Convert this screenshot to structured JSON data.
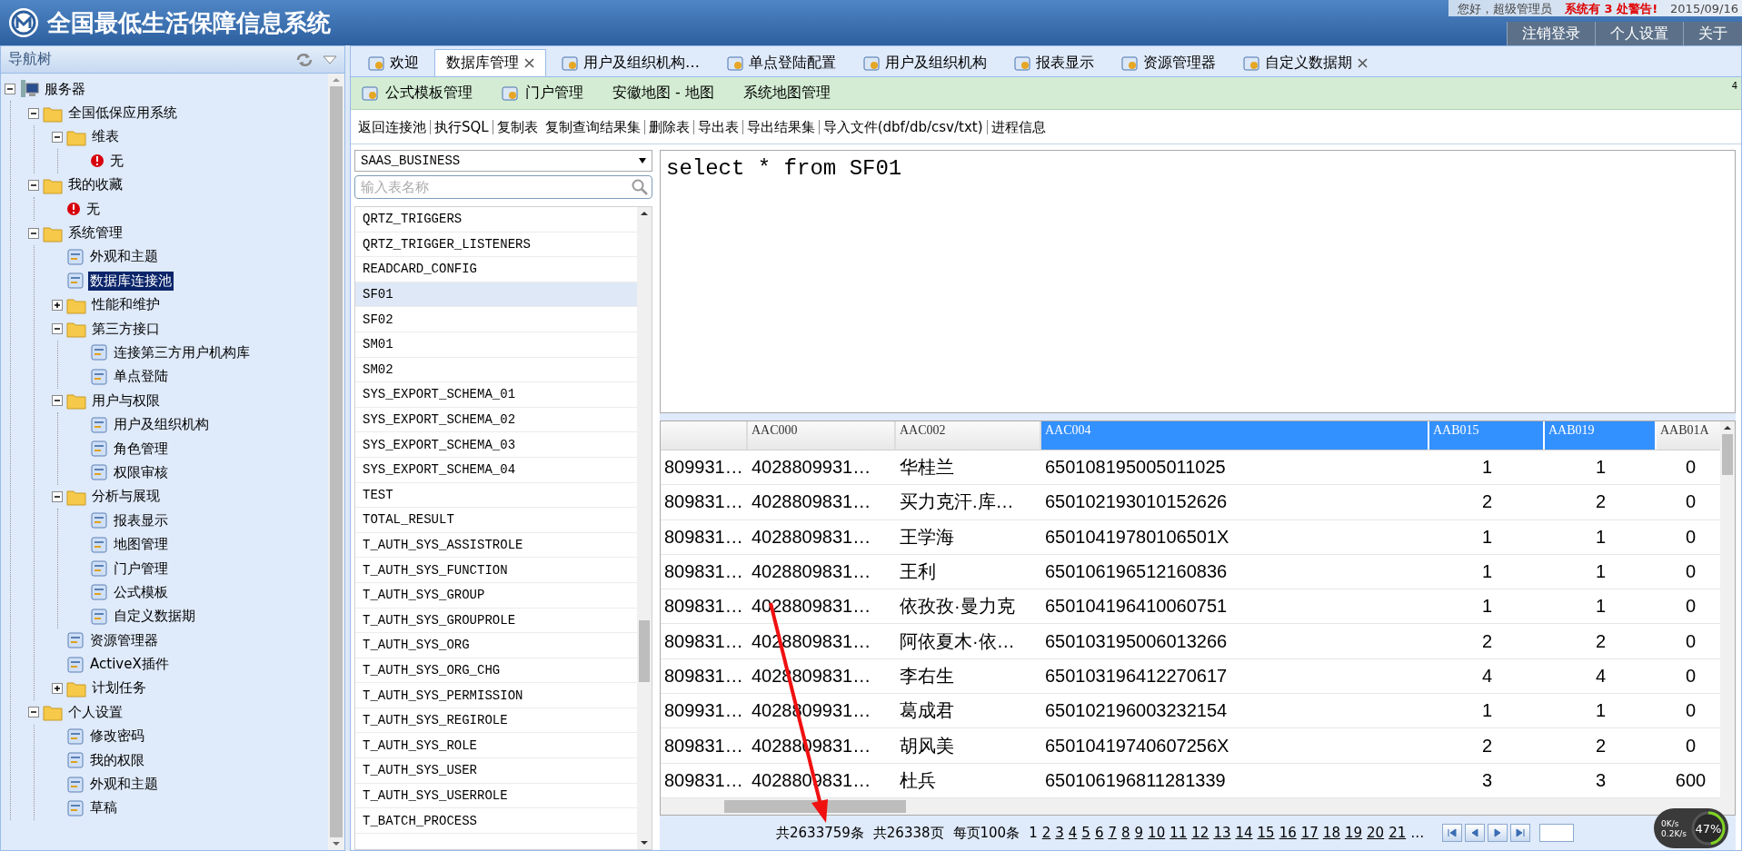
{
  "header": {
    "title": "全国最低生活保障信息系统",
    "greeting": "您好，超级管理员",
    "warning": "系统有 3 处警告!",
    "date": "2015/09/16",
    "buttons": [
      "注销登录",
      "个人设置",
      "关于"
    ]
  },
  "nav": {
    "title": "导航树",
    "tree": [
      {
        "label": "服务器",
        "kind": "server",
        "expanded": true,
        "selected": false,
        "children": [
          {
            "label": "全国低保应用系统",
            "kind": "folder",
            "expanded": true,
            "selected": false,
            "children": [
              {
                "label": "维表",
                "kind": "folder",
                "expanded": true,
                "selected": false,
                "children": [
                  {
                    "label": "无",
                    "kind": "warning",
                    "selected": false
                  }
                ]
              }
            ]
          },
          {
            "label": "我的收藏",
            "kind": "folder",
            "expanded": true,
            "selected": false,
            "children": [
              {
                "label": "无",
                "kind": "warning",
                "selected": false
              }
            ]
          },
          {
            "label": "系统管理",
            "kind": "folder",
            "expanded": true,
            "selected": false,
            "children": [
              {
                "label": "外观和主题",
                "kind": "item",
                "selected": false
              },
              {
                "label": "数据库连接池",
                "kind": "item",
                "selected": true
              },
              {
                "label": "性能和维护",
                "kind": "folder",
                "expanded": false,
                "selected": false
              },
              {
                "label": "第三方接口",
                "kind": "folder",
                "expanded": true,
                "selected": false,
                "children": [
                  {
                    "label": "连接第三方用户机构库",
                    "kind": "item",
                    "selected": false
                  },
                  {
                    "label": "单点登陆",
                    "kind": "item",
                    "selected": false
                  }
                ]
              },
              {
                "label": "用户与权限",
                "kind": "folder",
                "expanded": true,
                "selected": false,
                "children": [
                  {
                    "label": "用户及组织机构",
                    "kind": "item",
                    "selected": false
                  },
                  {
                    "label": "角色管理",
                    "kind": "item",
                    "selected": false
                  },
                  {
                    "label": "权限审核",
                    "kind": "item",
                    "selected": false
                  }
                ]
              },
              {
                "label": "分析与展现",
                "kind": "folder",
                "expanded": true,
                "selected": false,
                "children": [
                  {
                    "label": "报表显示",
                    "kind": "item",
                    "selected": false
                  },
                  {
                    "label": "地图管理",
                    "kind": "item",
                    "selected": false
                  },
                  {
                    "label": "门户管理",
                    "kind": "item",
                    "selected": false
                  },
                  {
                    "label": "公式模板",
                    "kind": "item",
                    "selected": false
                  },
                  {
                    "label": "自定义数据期",
                    "kind": "item",
                    "selected": false
                  }
                ]
              },
              {
                "label": "资源管理器",
                "kind": "item",
                "selected": false
              },
              {
                "label": "ActiveX插件",
                "kind": "item",
                "selected": false
              },
              {
                "label": "计划任务",
                "kind": "folder",
                "expanded": false,
                "selected": false
              }
            ]
          },
          {
            "label": "个人设置",
            "kind": "folder",
            "expanded": true,
            "selected": false,
            "children": [
              {
                "label": "修改密码",
                "kind": "item",
                "selected": false
              },
              {
                "label": "我的权限",
                "kind": "item",
                "selected": false
              },
              {
                "label": "外观和主题",
                "kind": "item",
                "selected": false
              },
              {
                "label": "草稿",
                "kind": "item",
                "selected": false
              }
            ]
          }
        ]
      }
    ]
  },
  "tabs": [
    {
      "label": "欢迎",
      "icon": true,
      "closable": false,
      "selected": false
    },
    {
      "label": "数据库管理",
      "icon": false,
      "closable": true,
      "selected": true
    },
    {
      "label": "用户及组织机构…",
      "icon": true,
      "closable": false,
      "selected": false
    },
    {
      "label": "单点登陆配置",
      "icon": true,
      "closable": false,
      "selected": false
    },
    {
      "label": "用户及组织机构",
      "icon": true,
      "closable": false,
      "selected": false
    },
    {
      "label": "报表显示",
      "icon": true,
      "closable": false,
      "selected": false
    },
    {
      "label": "资源管理器",
      "icon": true,
      "closable": false,
      "selected": false
    },
    {
      "label": "自定义数据期",
      "icon": true,
      "closable": true,
      "selected": false
    }
  ],
  "tab_count": "4",
  "subtabs": [
    {
      "label": "公式模板管理",
      "icon": true
    },
    {
      "label": "门户管理",
      "icon": true
    },
    {
      "label": "安徽地图 - 地图",
      "icon": false
    },
    {
      "label": "系统地图管理",
      "icon": false
    }
  ],
  "toolbar": [
    {
      "label": "返回连接池",
      "divider_after": true
    },
    {
      "label": "执行SQL",
      "divider_after": true
    },
    {
      "label": "复制表",
      "divider_after": false
    },
    {
      "label": "复制查询结果集",
      "divider_after": true
    },
    {
      "label": "删除表",
      "divider_after": true
    },
    {
      "label": "导出表",
      "divider_after": true
    },
    {
      "label": "导出结果集",
      "divider_after": true
    },
    {
      "label": "导入文件(dbf/db/csv/txt)",
      "divider_after": true
    },
    {
      "label": "进程信息",
      "divider_after": false
    }
  ],
  "db_select": "SAAS_BUSINESS",
  "table_search": {
    "placeholder": "输入表名称"
  },
  "tables": [
    {
      "name": "QRTZ_TRIGGERS",
      "selected": false
    },
    {
      "name": "QRTZ_TRIGGER_LISTENERS",
      "selected": false
    },
    {
      "name": "READCARD_CONFIG",
      "selected": false
    },
    {
      "name": "SF01",
      "selected": true
    },
    {
      "name": "SF02",
      "selected": false
    },
    {
      "name": "SM01",
      "selected": false
    },
    {
      "name": "SM02",
      "selected": false
    },
    {
      "name": "SYS_EXPORT_SCHEMA_01",
      "selected": false
    },
    {
      "name": "SYS_EXPORT_SCHEMA_02",
      "selected": false
    },
    {
      "name": "SYS_EXPORT_SCHEMA_03",
      "selected": false
    },
    {
      "name": "SYS_EXPORT_SCHEMA_04",
      "selected": false
    },
    {
      "name": "TEST",
      "selected": false
    },
    {
      "name": "TOTAL_RESULT",
      "selected": false
    },
    {
      "name": "T_AUTH_SYS_ASSISTROLE",
      "selected": false
    },
    {
      "name": "T_AUTH_SYS_FUNCTION",
      "selected": false
    },
    {
      "name": "T_AUTH_SYS_GROUP",
      "selected": false
    },
    {
      "name": "T_AUTH_SYS_GROUPROLE",
      "selected": false
    },
    {
      "name": "T_AUTH_SYS_ORG",
      "selected": false
    },
    {
      "name": "T_AUTH_SYS_ORG_CHG",
      "selected": false
    },
    {
      "name": "T_AUTH_SYS_PERMISSION",
      "selected": false
    },
    {
      "name": "T_AUTH_SYS_REGIROLE",
      "selected": false
    },
    {
      "name": "T_AUTH_SYS_ROLE",
      "selected": false
    },
    {
      "name": "T_AUTH_SYS_USER",
      "selected": false
    },
    {
      "name": "T_AUTH_SYS_USERROLE",
      "selected": false
    },
    {
      "name": "T_BATCH_PROCESS",
      "selected": false
    }
  ],
  "editor": {
    "sql": "select * from SF01"
  },
  "grid": {
    "columns": [
      {
        "selected": false
      },
      {
        "label": "AAC000",
        "selected": false
      },
      {
        "label": "AAC002",
        "selected": false
      },
      {
        "label": "AAC004",
        "selected": true
      },
      {
        "label": "AAB015",
        "selected": true
      },
      {
        "label": "AAB019",
        "selected": true
      },
      {
        "label": "AAB01A",
        "selected": false
      }
    ],
    "rows": [
      [
        "809931…",
        "4028809931…",
        "华桂兰",
        "650108195005011025",
        "1",
        "1",
        "0"
      ],
      [
        "809831…",
        "4028809831…",
        "买力克汗.库…",
        "650102193010152626",
        "2",
        "2",
        "0"
      ],
      [
        "809831…",
        "4028809831…",
        "王学海",
        "65010419780106501X",
        "1",
        "1",
        "0"
      ],
      [
        "809831…",
        "4028809831…",
        "王利",
        "650106196512160836",
        "1",
        "1",
        "0"
      ],
      [
        "809831…",
        "4028809831…",
        "依孜孜·曼力克",
        "650104196410060751",
        "1",
        "1",
        "0"
      ],
      [
        "809831…",
        "4028809831…",
        "阿依夏木·依…",
        "650103195006013266",
        "2",
        "2",
        "0"
      ],
      [
        "809831…",
        "4028809831…",
        "李右生",
        "650103196412270617",
        "4",
        "4",
        "0"
      ],
      [
        "809931…",
        "4028809931…",
        "葛成君",
        "650102196003232154",
        "1",
        "1",
        "0"
      ],
      [
        "809831…",
        "4028809831…",
        "胡风美",
        "65010419740607256X",
        "2",
        "2",
        "0"
      ],
      [
        "809831…",
        "4028809831…",
        "杜兵",
        "650106196811281339",
        "3",
        "3",
        "600"
      ]
    ]
  },
  "pagination": {
    "total": "共2633759条",
    "pages": "共26338页",
    "per_page": "每页100条",
    "page_links": [
      {
        "label": "1",
        "selected": true
      },
      {
        "label": "2",
        "selected": false
      },
      {
        "label": "3",
        "selected": false
      },
      {
        "label": "4",
        "selected": false
      },
      {
        "label": "5",
        "selected": false
      },
      {
        "label": "6",
        "selected": false
      },
      {
        "label": "7",
        "selected": false
      },
      {
        "label": "8",
        "selected": false
      },
      {
        "label": "9",
        "selected": false
      },
      {
        "label": "10",
        "selected": false
      },
      {
        "label": "11",
        "selected": false
      },
      {
        "label": "12",
        "selected": false
      },
      {
        "label": "13",
        "selected": false
      },
      {
        "label": "14",
        "selected": false
      },
      {
        "label": "15",
        "selected": false
      },
      {
        "label": "16",
        "selected": false
      },
      {
        "label": "17",
        "selected": false
      },
      {
        "label": "18",
        "selected": false
      },
      {
        "label": "19",
        "selected": false
      },
      {
        "label": "20",
        "selected": false
      },
      {
        "label": "21",
        "selected": false
      }
    ],
    "more": "…"
  },
  "speed_widget": {
    "upload": "0K/s",
    "download": "0.2K/s",
    "percent": "47%",
    "level": 0.47
  }
}
